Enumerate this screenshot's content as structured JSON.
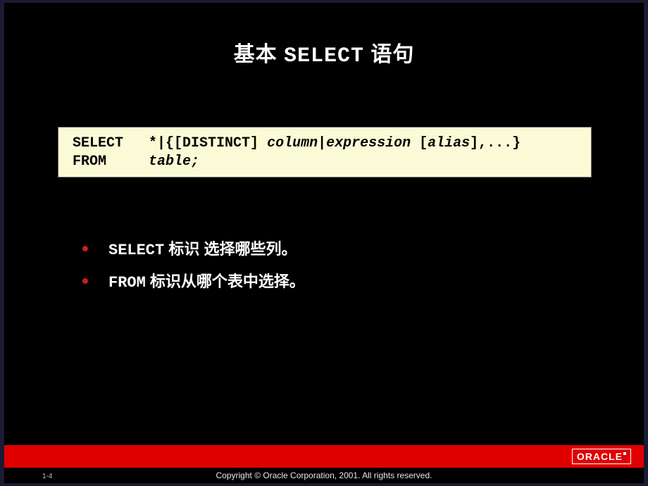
{
  "title": {
    "prefix": "基本 ",
    "keyword": "SELECT",
    "suffix": " 语句"
  },
  "code": {
    "line1_kw": "SELECT",
    "line1_pad": "   ",
    "line1_lit1": "*|{[DISTINCT] ",
    "line1_em1": "column",
    "line1_lit2": "|",
    "line1_em2": "expression",
    "line1_lit3": " [",
    "line1_em3": "alias",
    "line1_lit4": "],...}",
    "line2_kw": "FROM",
    "line2_pad": "     ",
    "line2_em": "table;"
  },
  "bullets": [
    {
      "kw": "SELECT",
      "text": " 标识 选择哪些列。"
    },
    {
      "kw": "FROM",
      "text": " 标识从哪个表中选择。"
    }
  ],
  "footer": {
    "page": "1-4",
    "copyright": "Copyright © Oracle Corporation, 2001. All rights reserved.",
    "logo": "ORACLE"
  }
}
